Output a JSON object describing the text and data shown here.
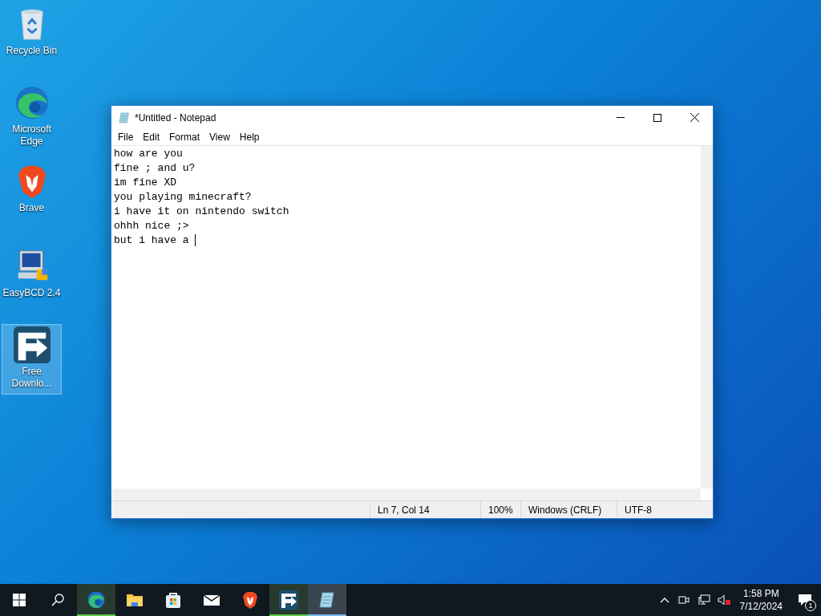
{
  "desktop_icons": [
    {
      "kind": "recycle",
      "label": "Recycle Bin",
      "selected": false
    },
    {
      "kind": "edge",
      "label": "Microsoft Edge",
      "selected": false
    },
    {
      "kind": "brave",
      "label": "Brave",
      "selected": false
    },
    {
      "kind": "easybcd",
      "label": "EasyBCD 2.4",
      "selected": false
    },
    {
      "kind": "fdm",
      "label": "Free Downlo...",
      "selected": true
    }
  ],
  "window": {
    "title": "*Untitled - Notepad",
    "menu": [
      "File",
      "Edit",
      "Format",
      "View",
      "Help"
    ],
    "lines": [
      "how are you",
      "fine ; and u?",
      "im fine XD",
      "you playing minecraft?",
      "i have it on nintendo switch",
      "ohhh nice ;>",
      "but i have a "
    ],
    "status_bar": [
      "Ln 7, Col 14",
      "100%",
      "Windows (CRLF)",
      "UTF-8"
    ]
  },
  "taskbar": {
    "apps": [
      {
        "kind": "edge",
        "running": true,
        "active": false
      },
      {
        "kind": "folder",
        "running": false,
        "active": false
      },
      {
        "kind": "store",
        "running": false,
        "active": false
      },
      {
        "kind": "mail",
        "running": false,
        "active": false
      },
      {
        "kind": "brave",
        "running": false,
        "active": false
      },
      {
        "kind": "fdm",
        "running": true,
        "active": false
      },
      {
        "kind": "notepad",
        "running": true,
        "active": true
      }
    ],
    "time": "1:58 PM",
    "date": "7/12/2024",
    "notifications": "1"
  }
}
